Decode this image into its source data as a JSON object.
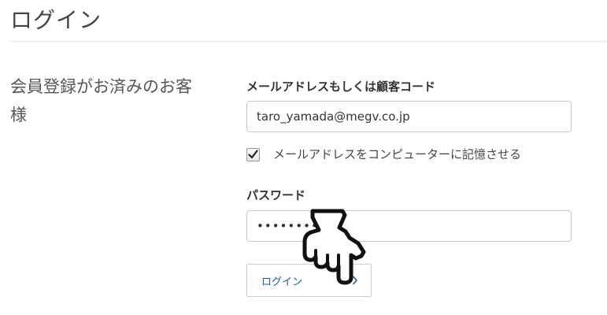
{
  "header": {
    "title": "ログイン"
  },
  "member_section": {
    "heading": "会員登録がお済みのお客様"
  },
  "form": {
    "email_label": "メールアドレスもしくは顧客コード",
    "email_value": "taro_yamada@megv.co.jp",
    "remember_label": "メールアドレスをコンピューターに記憶させる",
    "remember_checked": true,
    "password_label": "パスワード",
    "password_masked": "••••••••",
    "login_button_label": "ログイン"
  },
  "icons": {
    "checkbox_check": "check-icon",
    "button_arrow": "chevron-right-icon",
    "cursor": "hand-pointer-icon"
  },
  "colors": {
    "link_blue": "#1a5aa8",
    "text": "#333333",
    "border": "#c8c8c8"
  }
}
